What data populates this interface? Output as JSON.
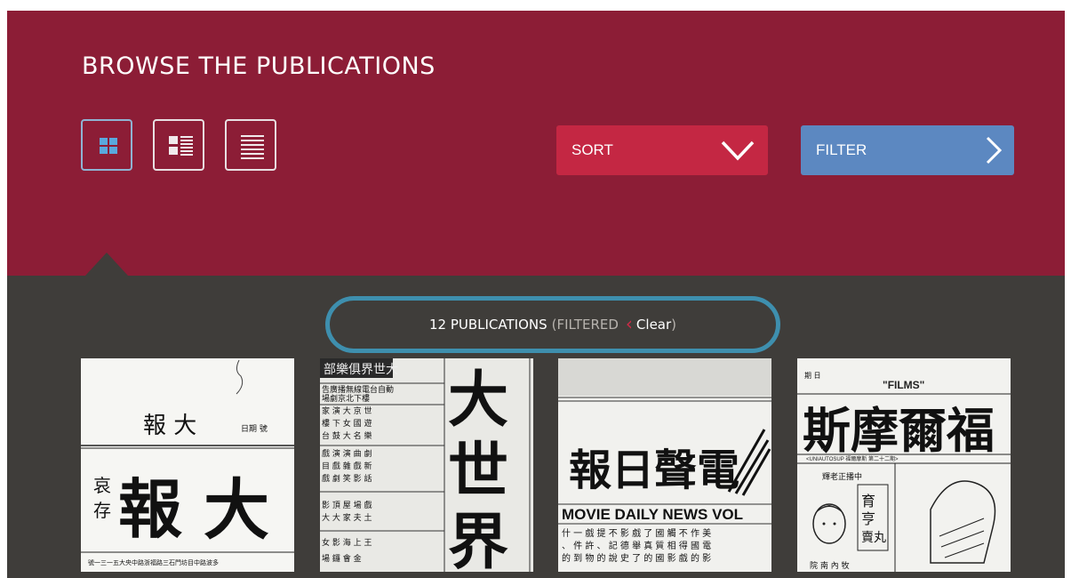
{
  "header": {
    "title": "BROWSE THE PUBLICATIONS",
    "views": [
      {
        "name": "grid-view",
        "active": true
      },
      {
        "name": "list-detail-view",
        "active": false
      },
      {
        "name": "list-view",
        "active": false
      }
    ],
    "sort_label": "SORT",
    "filter_label": "FILTER"
  },
  "results": {
    "count_text": "12 PUBLICATIONS",
    "filtered_text": "(FILTERED",
    "clear_label": "Clear",
    "close_paren": ")"
  },
  "thumbnails": [
    {
      "id": "da-bao",
      "masthead": "大報",
      "side_text": "哀 存",
      "small": "大 報"
    },
    {
      "id": "da-shi-jie",
      "masthead": "大世界",
      "header_text": "大世界俱樂部"
    },
    {
      "id": "dian-sheng-ri-bao",
      "masthead": "電聲日報",
      "english": "MOVIE DAILY NEWS VOL"
    },
    {
      "id": "fu-er-mo-si",
      "masthead": "福爾摩斯",
      "english": "\"FILMS\"",
      "sub": "FUERMOSI"
    }
  ],
  "colors": {
    "header_bg": "#8c1d36",
    "content_bg": "#3f3d3a",
    "sort_bg": "#c42743",
    "filter_bg": "#5c88c1",
    "pill_border": "#3e8fae"
  }
}
